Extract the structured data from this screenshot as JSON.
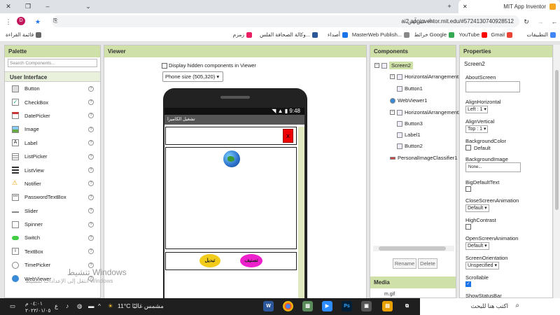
{
  "browser": {
    "tab_title": "MIT App Inventor",
    "url": "ai2.appinventor.mit.edu/#5724130740928512",
    "not_secure": "غير آمن",
    "profile_letter": "D",
    "bookmarks": [
      "التطبيقات",
      "Gmail",
      "YouTube",
      "خرائط Google",
      "MasterWeb Publish...",
      "أصداء",
      "وكالة الصحافة الفلس...",
      "زمزم",
      "قائمة القراءة"
    ]
  },
  "palette": {
    "title": "Palette",
    "search_placeholder": "Search Components...",
    "section": "User Interface",
    "items": [
      "Button",
      "CheckBox",
      "DatePicker",
      "Image",
      "Label",
      "ListPicker",
      "ListView",
      "Notifier",
      "PasswordTextBox",
      "Slider",
      "Spinner",
      "Switch",
      "TextBox",
      "TimePicker",
      "WebViewer"
    ],
    "help": "?"
  },
  "viewer": {
    "title": "Viewer",
    "hidden_label": "Display hidden components in Viewer",
    "phone_size": "Phone size (505,320)",
    "status_time": "9:48",
    "screen_title": "تشغيل الكاميرا",
    "button1_text": "x",
    "button3_text": "تبديل",
    "button2_text": "تصنيف"
  },
  "components": {
    "title": "Components",
    "tree": [
      "Screen2",
      "HorizontalArrangement1",
      "Button1",
      "WebViewer1",
      "HorizontalArrangement2",
      "Button3",
      "Label1",
      "Button2",
      "PersonalImageClassifier1"
    ],
    "rename": "Rename",
    "delete": "Delete",
    "media_title": "Media",
    "media_item": "m.gif"
  },
  "properties": {
    "title": "Properties",
    "screen": "Screen2",
    "about": "AboutScreen",
    "align_h": "AlignHorizontal",
    "align_h_val": "Left : 1 ▾",
    "align_v": "AlignVertical",
    "align_v_val": "Top : 1 ▾",
    "bg_color": "BackgroundColor",
    "bg_color_val": "Default",
    "bg_image": "BackgroundImage",
    "bg_image_val": "None...",
    "big_default": "BigDefaultText",
    "close_anim": "CloseScreenAnimation",
    "close_anim_val": "Default ▾",
    "high_contrast": "HighContrast",
    "open_anim": "OpenScreenAnimation",
    "open_anim_val": "Default ▾",
    "orientation": "ScreenOrientation",
    "orientation_val": "Unspecified ▾",
    "scrollable": "Scrollable",
    "show_status": "ShowStatusBar"
  },
  "watermark": {
    "line1": "تنشيط Windows",
    "line2": "انتقل إلى الإعدادات لتنشيط Windows"
  },
  "taskbar": {
    "search": "اكتب هنا للبحث",
    "weather": "11°C مشمس غالبًا",
    "lang": "ع",
    "time": "٠٤:٠١ م",
    "date": "٢٠٢٢/٠١/٠٥"
  }
}
